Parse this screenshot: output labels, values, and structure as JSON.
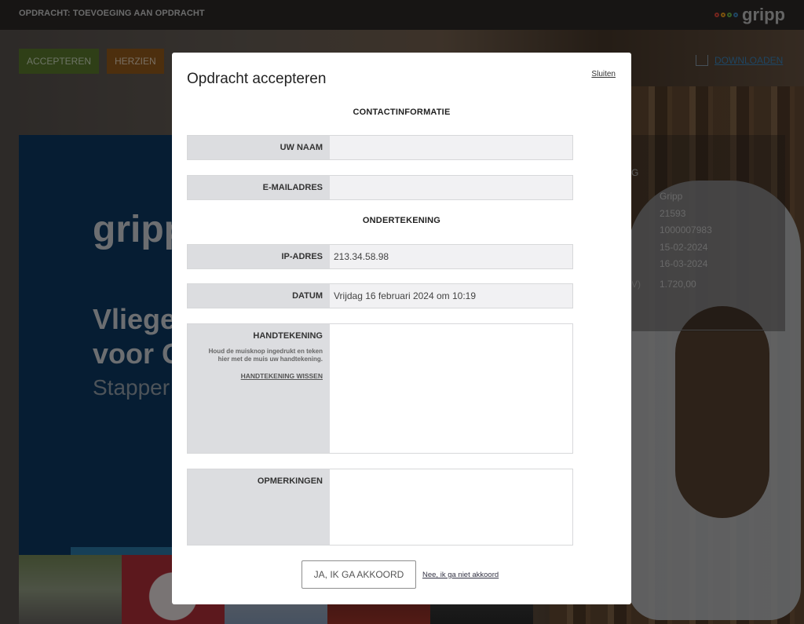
{
  "header": {
    "title": "OPDRACHT: TOEVOEGING AAN OPDRACHT",
    "logo_text": "gripp",
    "logo_colors": [
      "#e84b3c",
      "#f7a21b",
      "#6fbf4a",
      "#3e8bc4"
    ]
  },
  "toolbar": {
    "accept_label": "ACCEPTEREN",
    "review_label": "HERZIEN",
    "download_label": "DOWNLOADEN",
    "download_icon": "download-icon"
  },
  "background_card": {
    "logo_text": "gripp",
    "headline_line1": "Vliege",
    "headline_line2": "voor G",
    "subline": "Stapper"
  },
  "background_details": {
    "header_fragment": "G",
    "amount_label_fragment": "V)",
    "values": [
      "Gripp",
      "21593",
      "1000007983",
      "15-02-2024",
      "16-03-2024",
      "1.720,00"
    ]
  },
  "modal": {
    "title": "Opdracht accepteren",
    "close_label": "Sluiten",
    "contact_heading": "CONTACTINFORMATIE",
    "signing_heading": "ONDERTEKENING",
    "fields": {
      "name": {
        "label": "UW NAAM",
        "value": ""
      },
      "email": {
        "label": "E-MAILADRES",
        "value": ""
      },
      "ip": {
        "label": "IP-ADRES",
        "value": "213.34.58.98"
      },
      "date": {
        "label": "DATUM",
        "value": "Vrijdag 16 februari 2024 om  10:19"
      },
      "signature": {
        "label": "HANDTEKENING",
        "hint": "Houd de muisknop ingedrukt en teken hier met de muis uw handtekening.",
        "clear_label": "HANDTEKENING WISSEN"
      },
      "remarks": {
        "label": "OPMERKINGEN",
        "value": ""
      }
    },
    "agree_label": "JA, IK GA AKKOORD",
    "decline_label": "Nee, ik ga niet akkoord"
  }
}
